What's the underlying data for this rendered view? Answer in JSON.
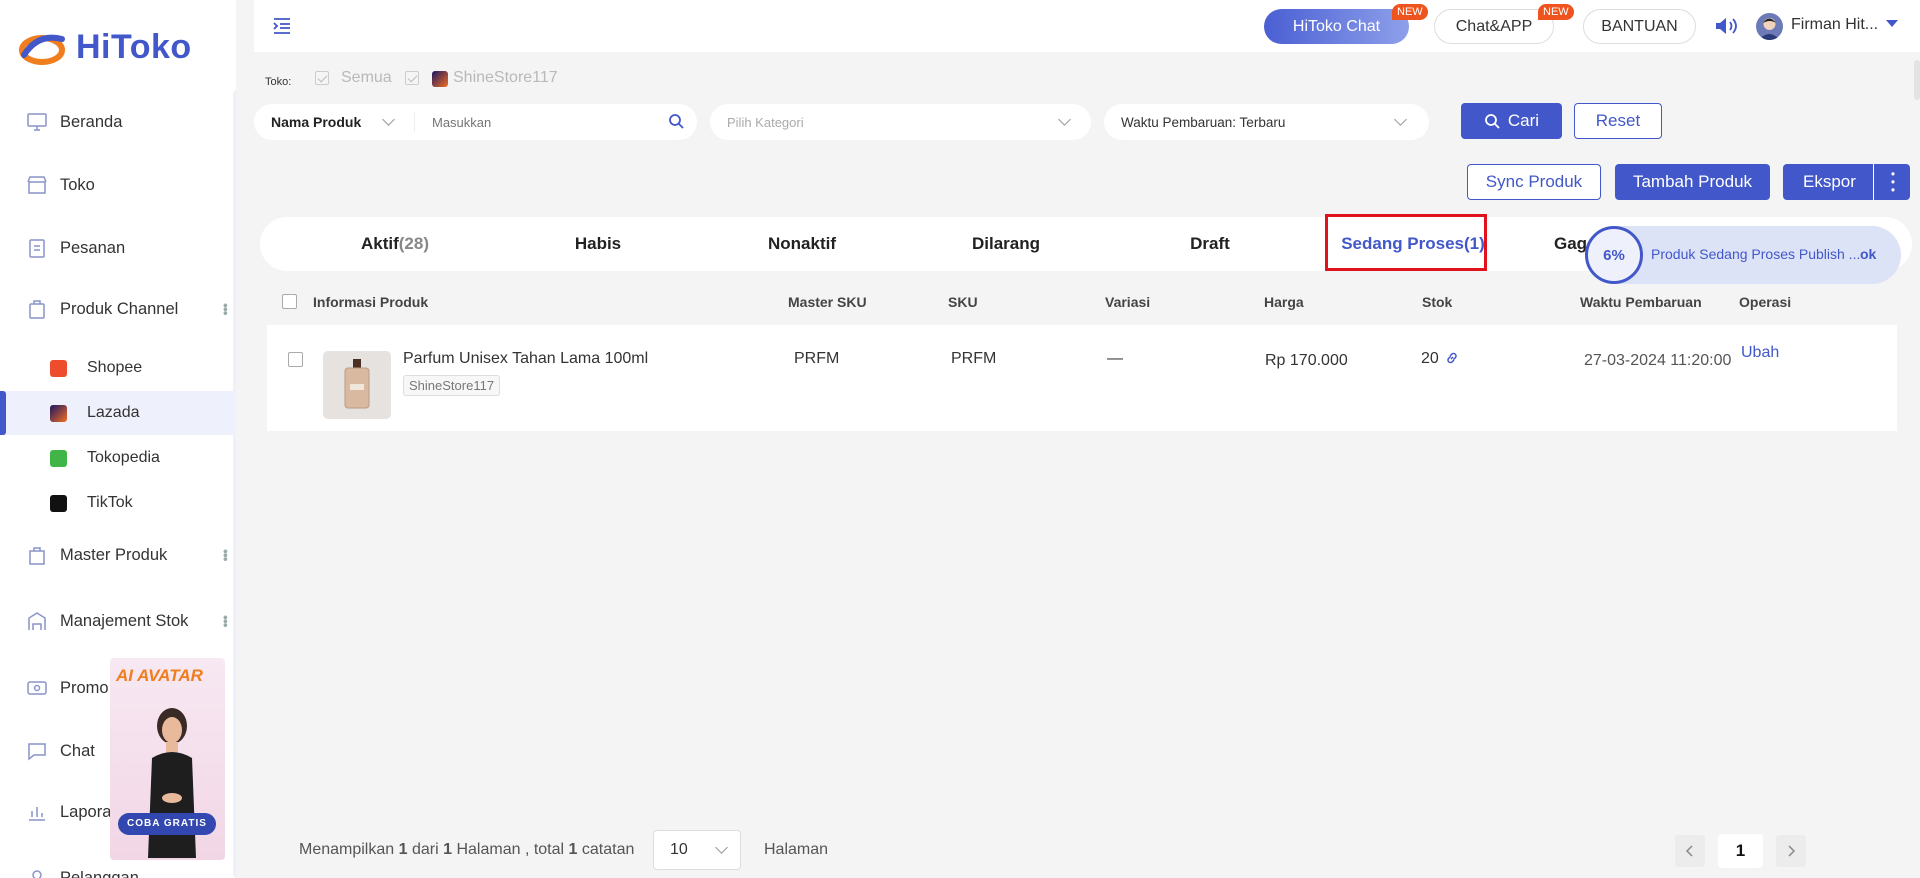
{
  "app": {
    "logo_text": "HiToko"
  },
  "sidebar": {
    "items": [
      {
        "label": "Beranda"
      },
      {
        "label": "Toko"
      },
      {
        "label": "Pesanan"
      },
      {
        "label": "Produk Channel"
      },
      {
        "label": "Master Produk"
      },
      {
        "label": "Manajement Stok"
      },
      {
        "label": "Promo"
      },
      {
        "label": "Chat"
      },
      {
        "label": "Lapora"
      },
      {
        "label": "Pelanggan"
      }
    ],
    "channels": [
      {
        "label": "Shopee",
        "color": "#ee4d2d"
      },
      {
        "label": "Lazada",
        "color": "#1a1464"
      },
      {
        "label": "Tokopedia",
        "color": "#42b549"
      },
      {
        "label": "TikTok",
        "color": "#111111"
      }
    ],
    "ad": {
      "title": "AI AVATAR",
      "button": "COBA GRATIS"
    }
  },
  "header": {
    "chat_label": "HiToko Chat",
    "chat_badge": "NEW",
    "app_label": "Chat&APP",
    "app_badge": "NEW",
    "help_label": "BANTUAN",
    "username": "Firman Hit..."
  },
  "filters": {
    "toko_label": "Toko:",
    "toko_all": "Semua",
    "toko_store": "ShineStore117",
    "field_select": "Nama Produk",
    "search_placeholder": "Masukkan",
    "category_placeholder": "Pilih Kategori",
    "sort_select": "Waktu Pembaruan: Terbaru",
    "search_button": "Cari",
    "reset_button": "Reset"
  },
  "actions": {
    "sync": "Sync Produk",
    "add": "Tambah Produk",
    "export": "Ekspor"
  },
  "tabs": [
    {
      "label": "Aktif",
      "count": "(28)"
    },
    {
      "label": "Habis",
      "count": ""
    },
    {
      "label": "Nonaktif",
      "count": ""
    },
    {
      "label": "Dilarang",
      "count": ""
    },
    {
      "label": "Draft",
      "count": ""
    },
    {
      "label": "Sedang Proses",
      "count": "(1)"
    },
    {
      "label": "Gag",
      "count": ""
    }
  ],
  "progress": {
    "percent": "6%",
    "text": "Produk Sedang Proses Publish ...",
    "ok": "ok"
  },
  "table": {
    "headers": [
      "Informasi Produk",
      "Master SKU",
      "SKU",
      "Variasi",
      "Harga",
      "Stok",
      "Waktu Pembaruan",
      "Operasi"
    ],
    "rows": [
      {
        "name": "Parfum Unisex Tahan Lama 100ml",
        "store": "ShineStore117",
        "master_sku": "PRFM",
        "sku": "PRFM",
        "variasi": "—",
        "harga": "Rp 170.000",
        "stok": "20",
        "waktu": "27-03-2024 11:20:00",
        "operasi": "Ubah"
      }
    ]
  },
  "footer": {
    "prefix": "Menampilkan",
    "current": "1",
    "dari": "dari",
    "pages": "1",
    "halaman": "Halaman , total",
    "total": "1",
    "catatan": "catatan",
    "page_size": "10",
    "halaman_label": "Halaman",
    "current_page": "1"
  },
  "colors": {
    "accent": "#4257c9",
    "highlight": "#e0121b",
    "badge": "#f0541e"
  }
}
